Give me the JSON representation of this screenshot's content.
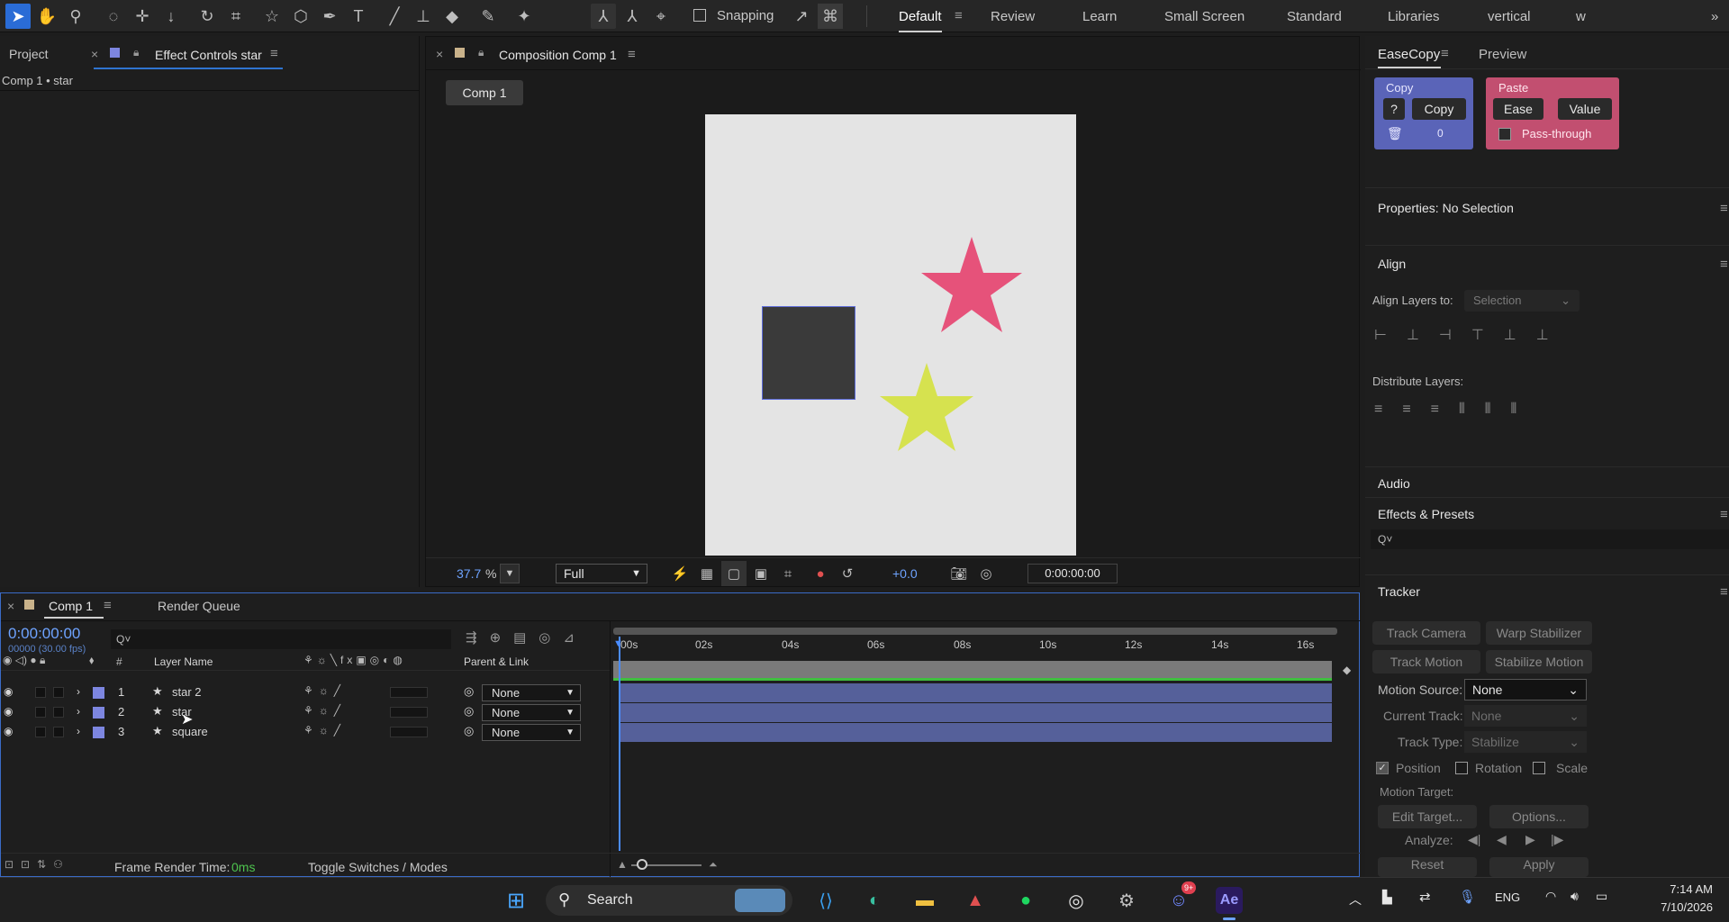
{
  "toolbar": {
    "snapping_label": "Snapping",
    "workspaces": [
      "Default",
      "Review",
      "Learn",
      "Small Screen",
      "Standard",
      "Libraries",
      "vertical",
      "w"
    ],
    "more_label": "»"
  },
  "left_panel": {
    "tab_project": "Project",
    "tab_effect_controls": "Effect Controls star",
    "subtitle": "Comp 1 • star"
  },
  "composition": {
    "tab_label": "Composition Comp 1",
    "comp_button": "Comp 1",
    "zoom_value": "37.7",
    "zoom_unit": "%",
    "resolution": "Full",
    "exposure": "+0.0",
    "timecode": "0:00:00:00",
    "colors": {
      "canvas": "#e4e4e4",
      "square": "#3a3a3a",
      "pink_star": "#e6527a",
      "yellow_star": "#d6e24f"
    }
  },
  "easecopy": {
    "tab_easecopy": "EaseCopy",
    "tab_preview": "Preview",
    "copy_title": "Copy",
    "paste_title": "Paste",
    "help_label": "?",
    "copy_button": "Copy",
    "ease_button": "Ease",
    "value_button": "Value",
    "count_value": "0",
    "passthrough_label": "Pass-through"
  },
  "properties": {
    "title": "Properties: No Selection"
  },
  "align": {
    "title": "Align",
    "align_to_label": "Align Layers to:",
    "align_to_value": "Selection",
    "distribute_label": "Distribute Layers:"
  },
  "audio": {
    "title": "Audio"
  },
  "effects": {
    "title": "Effects & Presets",
    "search_icon_text": "Q˅"
  },
  "tracker": {
    "title": "Tracker",
    "track_camera": "Track Camera",
    "warp_stabilizer": "Warp Stabilizer",
    "track_motion": "Track Motion",
    "stabilize_motion": "Stabilize Motion",
    "motion_source_label": "Motion Source:",
    "motion_source_value": "None",
    "current_track_label": "Current Track:",
    "current_track_value": "None",
    "track_type_label": "Track Type:",
    "track_type_value": "Stabilize",
    "position_label": "Position",
    "rotation_label": "Rotation",
    "scale_label": "Scale",
    "motion_target_label": "Motion Target:",
    "edit_target": "Edit Target...",
    "options": "Options...",
    "analyze_label": "Analyze:",
    "reset": "Reset",
    "apply": "Apply"
  },
  "timeline": {
    "tab_comp": "Comp 1",
    "tab_render_queue": "Render Queue",
    "current_time": "0:00:00:00",
    "frame_info": "00000 (30.00 fps)",
    "search_placeholder": "Q˅",
    "col_number": "#",
    "col_layer_name": "Layer Name",
    "col_parent": "Parent & Link",
    "time_ticks": [
      "00s",
      "02s",
      "04s",
      "06s",
      "08s",
      "10s",
      "12s",
      "14s",
      "16s"
    ],
    "layers": [
      {
        "number": "1",
        "name": "star 2",
        "parent": "None"
      },
      {
        "number": "2",
        "name": "star",
        "parent": "None"
      },
      {
        "number": "3",
        "name": "square",
        "parent": "None"
      }
    ],
    "frame_render_label": "Frame Render Time:",
    "frame_render_value": "0ms",
    "toggle_label": "Toggle Switches / Modes"
  },
  "taskbar": {
    "search_label": "Search",
    "language": "ENG",
    "time": "7:14 AM",
    "date": "7/10/2026",
    "discord_badge": "9+",
    "ae_label": "Ae"
  }
}
